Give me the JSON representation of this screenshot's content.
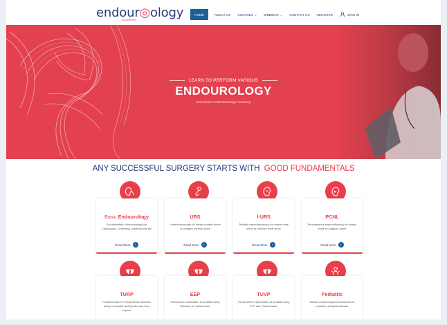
{
  "header": {
    "logo_text_a": "endour",
    "logo_text_b": "ology",
    "logo_sub": "academy",
    "nav": [
      {
        "label": "HOME",
        "active": true
      },
      {
        "label": "ABOUT US"
      },
      {
        "label": "COURSES",
        "caret": "⌄"
      },
      {
        "label": "WEBINAR",
        "caret": "⌄"
      },
      {
        "label": "CONTACT US"
      },
      {
        "label": "REGISTER"
      }
    ],
    "sign_in": "SIGN IN"
  },
  "hero": {
    "kicker": "LEARN TO PERFORM VARIOUS",
    "title": "ENDOUROLOGY",
    "subtitle": "procedures at Endourology Academy"
  },
  "section": {
    "title_a": "ANY SUCCESSFUL SURGERY STARTS WITH",
    "title_b": "GOOD FUNDAMENTALS"
  },
  "cards": [
    {
      "title_plain": "Basic",
      "title": "Endourology",
      "desc": "Fundamentals of endourology like Cystoscopy, JJ stenting, Ureteroscopy etc",
      "read_more": "Read More",
      "icon": "kidney-icon"
    },
    {
      "title": "URS",
      "desc": "Ureterorenoscopy for simple ureteric stone to complex ureteric stone",
      "read_more": "Read More",
      "icon": "ureter-icon"
    },
    {
      "title": "f-URS",
      "desc": "Flexible ureterorenoscopy for simple renal stone to complex renal stone",
      "read_more": "Read More",
      "icon": "renal-icon"
    },
    {
      "title": "PCNL",
      "desc": "Percutaneous nephrolithotomy for simple stone to staghorn stone",
      "read_more": "Read More",
      "icon": "kidney-stone-icon"
    },
    {
      "title": "TURP",
      "desc": "Fundamentals of Transurethral resection using monopolar and bipolar loop from experts",
      "read_more": "",
      "icon": "prostate-icon"
    },
    {
      "title": "EEP",
      "desc": "Endoscopic enucleation of prostate using Holmium & Thulium laser",
      "read_more": "",
      "icon": "prostate-laser-icon"
    },
    {
      "title": "TUVP",
      "desc": "Transurethral vaporization of prostate using KTP and Thulium laser",
      "read_more": "",
      "icon": "prostate-vapor-icon"
    },
    {
      "title": "Pediatric",
      "desc": "Various endourological procedures for pediatric urological disease",
      "read_more": "",
      "icon": "child-icon"
    }
  ],
  "colors": {
    "brand_red": "#e8404a",
    "navy": "#2a3b7a",
    "nav_active": "#1f5f99"
  }
}
